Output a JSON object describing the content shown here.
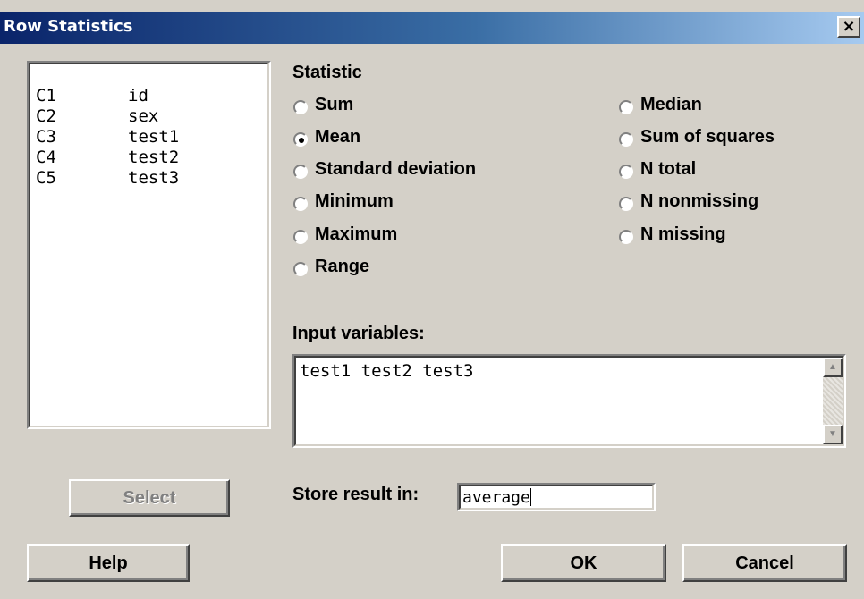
{
  "window": {
    "title": "Row Statistics",
    "close_glyph": "×",
    "colors": {
      "background": "#d4d0c8",
      "title_bar_start": "#0a246a",
      "title_bar_end": "#a6caf0"
    }
  },
  "variable_list": {
    "items": [
      {
        "col": "C1",
        "name": "id"
      },
      {
        "col": "C2",
        "name": "sex"
      },
      {
        "col": "C3",
        "name": "test1"
      },
      {
        "col": "C4",
        "name": "test2"
      },
      {
        "col": "C5",
        "name": "test3"
      }
    ]
  },
  "statistic": {
    "label": "Statistic",
    "selected": "Mean",
    "options": [
      {
        "label": "Sum",
        "checked": false
      },
      {
        "label": "Mean",
        "checked": true
      },
      {
        "label": "Standard deviation",
        "checked": false
      },
      {
        "label": "Minimum",
        "checked": false
      },
      {
        "label": "Maximum",
        "checked": false
      },
      {
        "label": "Range",
        "checked": false
      },
      {
        "label": "Median",
        "checked": false
      },
      {
        "label": "Sum of squares",
        "checked": false
      },
      {
        "label": "N total",
        "checked": false
      },
      {
        "label": "N nonmissing",
        "checked": false
      },
      {
        "label": "N missing",
        "checked": false
      }
    ]
  },
  "input_variables": {
    "label": "Input variables:",
    "value": "test1 test2 test3"
  },
  "store_result": {
    "label": "Store result in:",
    "value": "average"
  },
  "buttons": {
    "select": "Select",
    "help": "Help",
    "ok": "OK",
    "cancel": "Cancel"
  },
  "icons": {
    "scroll_up": "arrow-up-icon",
    "scroll_down": "arrow-down-icon",
    "close": "close-icon"
  }
}
